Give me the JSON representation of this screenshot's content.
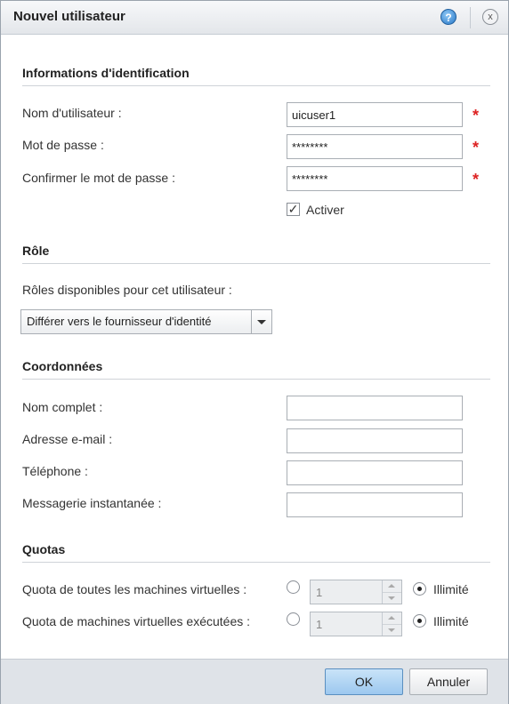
{
  "dialog": {
    "title": "Nouvel utilisateur",
    "help_icon": "?",
    "close_icon": "x"
  },
  "credentials": {
    "heading": "Informations d'identification",
    "username_label": "Nom d'utilisateur :",
    "username_value": "uicuser1",
    "password_label": "Mot de passe :",
    "password_value": "********",
    "confirm_label": "Confirmer le mot de passe :",
    "confirm_value": "********",
    "required_marker": "*",
    "activate_label": "Activer",
    "activate_checked": true
  },
  "role": {
    "heading": "Rôle",
    "available_label": "Rôles disponibles pour cet utilisateur :",
    "selected": "Différer vers le fournisseur d'identité"
  },
  "contact": {
    "heading": "Coordonnées",
    "fullname_label": "Nom complet :",
    "email_label": "Adresse e-mail :",
    "phone_label": "Téléphone :",
    "im_label": "Messagerie instantanée :"
  },
  "quotas": {
    "heading": "Quotas",
    "all_vms_label": "Quota de toutes les machines virtuelles :",
    "all_vms_value": "1",
    "running_vms_label": "Quota de machines virtuelles exécutées :",
    "running_vms_value": "1",
    "unlimited_label": "Illimité"
  },
  "footer": {
    "ok_label": "OK",
    "cancel_label": "Annuler"
  }
}
